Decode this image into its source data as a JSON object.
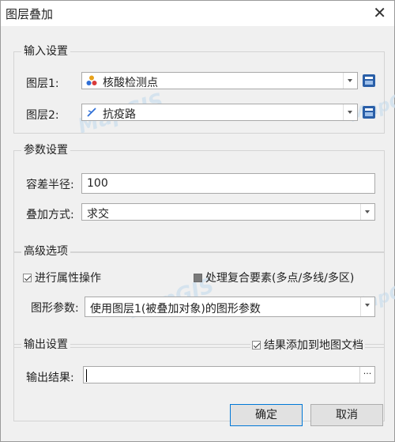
{
  "window": {
    "title": "图层叠加",
    "close_glyph": "✕"
  },
  "input_settings": {
    "legend": "输入设置",
    "layer1": {
      "label": "图层1:",
      "value": "核酸检测点",
      "icon": "point-layer-icon"
    },
    "layer2": {
      "label": "图层2:",
      "value": "抗疫路",
      "icon": "line-layer-icon"
    }
  },
  "param_settings": {
    "legend": "参数设置",
    "tolerance": {
      "label": "容差半径:",
      "value": "100"
    },
    "method": {
      "label": "叠加方式:",
      "value": "求交"
    }
  },
  "advanced": {
    "legend": "高级选项",
    "attr_op": {
      "label": "进行属性操作",
      "checked": true
    },
    "complex": {
      "label": "处理复合要素(多点/多线/多区)",
      "checked": false
    },
    "graphic": {
      "label": "图形参数:",
      "value": "使用图层1(被叠加对象)的图形参数"
    }
  },
  "output": {
    "legend": "输出设置",
    "add_to_map": {
      "label": "结果添加到地图文档",
      "checked": true
    },
    "result": {
      "label": "输出结果:",
      "value": "",
      "browse": "···"
    }
  },
  "buttons": {
    "ok": "确定",
    "cancel": "取消"
  },
  "watermark": "MapGIS",
  "colors": {
    "accent": "#0078d7",
    "db_icon": "#2a5fa8"
  }
}
